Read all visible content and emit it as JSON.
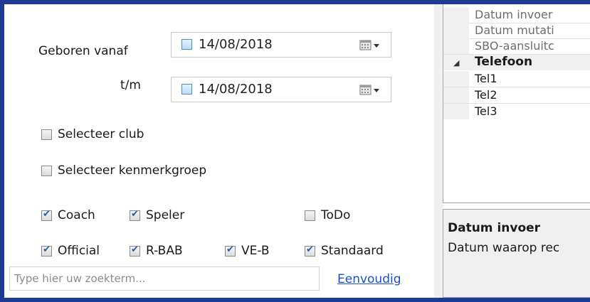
{
  "filter": {
    "born_from_label": "Geboren vanaf",
    "born_from_value": "14/08/2018",
    "until_label": "t/m",
    "until_value": "14/08/2018",
    "select_club_label": "Selecteer club",
    "select_group_label": "Selecteer kenmerkgroep",
    "roles": [
      {
        "label": "Coach",
        "checked": true
      },
      {
        "label": "Speler",
        "checked": true
      },
      {
        "label": "ToDo",
        "checked": false
      },
      {
        "label": "Official",
        "checked": true
      },
      {
        "label": "R-BAB",
        "checked": true
      },
      {
        "label": "VE-B",
        "checked": true
      },
      {
        "label": "Standaard",
        "checked": true
      }
    ]
  },
  "search": {
    "placeholder": "Type hier uw zoekterm...",
    "mode_link": "Eenvoudig"
  },
  "properties": {
    "rows": [
      {
        "label": "Datum invoer"
      },
      {
        "label": "Datum mutati"
      },
      {
        "label": "SBO-aansluitc"
      },
      {
        "label": "Telefoon"
      },
      {
        "label": "Tel1"
      },
      {
        "label": "Tel2"
      },
      {
        "label": "Tel3"
      }
    ],
    "description_title": "Datum invoer",
    "description_body": "Datum waarop rec"
  },
  "colors": {
    "frame": "#1f3a93",
    "link": "#1a4fcf"
  }
}
